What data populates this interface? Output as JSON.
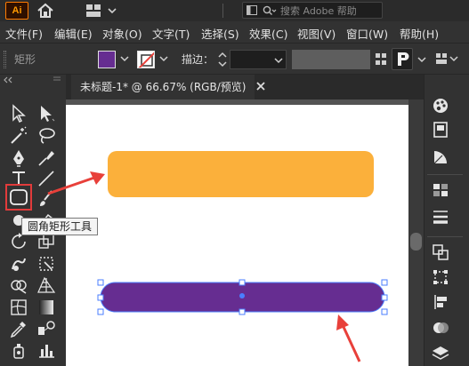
{
  "app": {
    "logo_text": "Ai",
    "search_placeholder": "搜索 Adobe 帮助"
  },
  "menu": {
    "items": [
      {
        "label": "文件(F)"
      },
      {
        "label": "编辑(E)"
      },
      {
        "label": "对象(O)"
      },
      {
        "label": "文字(T)"
      },
      {
        "label": "选择(S)"
      },
      {
        "label": "效果(C)"
      },
      {
        "label": "视图(V)"
      },
      {
        "label": "窗口(W)"
      },
      {
        "label": "帮助(H)"
      }
    ]
  },
  "control_bar": {
    "shape_label": "矩形",
    "stroke_label": "描边：",
    "fill_color": "#662d91",
    "stroke_color": "none"
  },
  "document": {
    "tab_title": "未标题-1* @ 66.67% (RGB/预览)"
  },
  "tooltip": {
    "text": "圆角矩形工具"
  },
  "canvas": {
    "shape1_color": "#fbb03b",
    "shape2_color": "#662d91",
    "annotation_color": "#e8403a",
    "selection_color": "#4a7eff"
  },
  "tools": [
    "selection-tool-icon",
    "direct-selection-tool-icon",
    "magic-wand-tool-icon",
    "lasso-tool-icon",
    "pen-tool-icon",
    "curvature-tool-icon",
    "type-tool-icon",
    "line-segment-tool-icon",
    "rounded-rectangle-tool-icon",
    "paintbrush-tool-icon",
    "shaper-tool-icon",
    "eraser-tool-icon",
    "rotate-tool-icon",
    "scale-tool-icon",
    "warp-tool-icon",
    "free-transform-tool-icon",
    "shape-builder-tool-icon",
    "perspective-grid-tool-icon",
    "mesh-tool-icon",
    "gradient-tool-icon",
    "eyedropper-tool-icon",
    "blend-tool-icon",
    "symbol-sprayer-tool-icon",
    "column-graph-tool-icon"
  ],
  "right_panel_icons": [
    "color-panel-icon",
    "libraries-panel-icon",
    "color-guide-panel-icon",
    "swatches-panel-icon",
    "stroke-panel-icon",
    "transform-panel-icon",
    "align-panel-icon",
    "pathfinder-panel-icon",
    "appearance-panel-icon",
    "layers-panel-icon"
  ]
}
